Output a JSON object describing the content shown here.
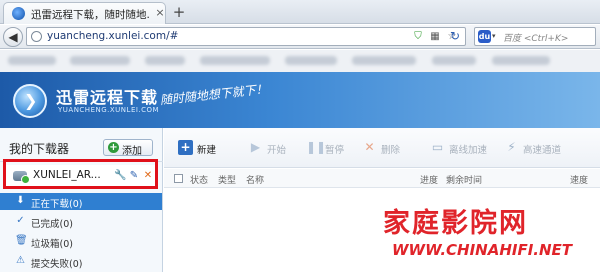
{
  "browser": {
    "tab_title": "迅雷远程下载，随时随地...",
    "tab_close": "×",
    "new_tab": "+",
    "back": "◀",
    "url": "yuancheng.xunlei.com/#",
    "search_placeholder": "百度 <Ctrl+K>",
    "search_engine_glyph": "du",
    "icons": {
      "shield": "⛉",
      "qr": "▦",
      "star": "☆",
      "refresh": "↻",
      "dropdown": "▾"
    }
  },
  "header": {
    "logo_title": "迅雷远程下载",
    "logo_domain": "YUANCHENG.XUNLEI.COM",
    "slogan": "随时随地想下就下！"
  },
  "sidebar": {
    "title": "我的下载器",
    "add_label": "添加",
    "add_glyph": "+",
    "device_name": "XUNLEI_AR...",
    "device_actions": {
      "wrench": "🔧",
      "edit": "✎",
      "delete": "✕"
    },
    "items": [
      {
        "label": "正在下载(0)",
        "icon": "⬇",
        "active": true
      },
      {
        "label": "已完成(0)",
        "icon": "✓",
        "active": false
      },
      {
        "label": "垃圾箱(0)",
        "icon": "🗑",
        "active": false
      },
      {
        "label": "提交失败(0)",
        "icon": "⚠",
        "active": false
      }
    ]
  },
  "toolbar": {
    "new": {
      "label": "新建",
      "icon": "+"
    },
    "start": {
      "label": "开始",
      "icon": "▶"
    },
    "pause": {
      "label": "暂停",
      "icon": "❚❚"
    },
    "delete": {
      "label": "删除",
      "icon": "✕"
    },
    "offline": {
      "label": "离线加速",
      "icon": "▭"
    },
    "highspeed": {
      "label": "高速通道",
      "icon": "⚡"
    }
  },
  "table": {
    "columns": [
      "状态",
      "类型",
      "名称",
      "进度",
      "剩余时间",
      "速度"
    ]
  },
  "watermark": {
    "title": "家庭影院网",
    "url": "WWW.CHINAHIFI.NET"
  },
  "colors": {
    "accent": "#2f7fd1",
    "highlight_frame": "#e0101a",
    "watermark": "#e0242a"
  }
}
